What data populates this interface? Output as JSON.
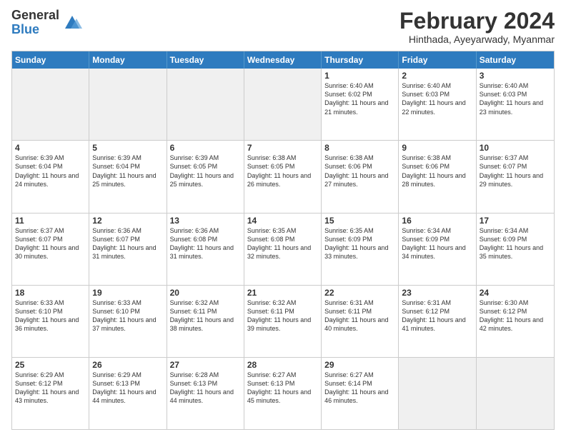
{
  "logo": {
    "general": "General",
    "blue": "Blue"
  },
  "title": "February 2024",
  "subtitle": "Hinthada, Ayeyarwady, Myanmar",
  "days": [
    "Sunday",
    "Monday",
    "Tuesday",
    "Wednesday",
    "Thursday",
    "Friday",
    "Saturday"
  ],
  "weeks": [
    [
      {
        "day": "",
        "lines": []
      },
      {
        "day": "",
        "lines": []
      },
      {
        "day": "",
        "lines": []
      },
      {
        "day": "",
        "lines": []
      },
      {
        "day": "1",
        "lines": [
          "Sunrise: 6:40 AM",
          "Sunset: 6:02 PM",
          "Daylight: 11 hours and 21 minutes."
        ]
      },
      {
        "day": "2",
        "lines": [
          "Sunrise: 6:40 AM",
          "Sunset: 6:03 PM",
          "Daylight: 11 hours and 22 minutes."
        ]
      },
      {
        "day": "3",
        "lines": [
          "Sunrise: 6:40 AM",
          "Sunset: 6:03 PM",
          "Daylight: 11 hours and 23 minutes."
        ]
      }
    ],
    [
      {
        "day": "4",
        "lines": [
          "Sunrise: 6:39 AM",
          "Sunset: 6:04 PM",
          "Daylight: 11 hours and 24 minutes."
        ]
      },
      {
        "day": "5",
        "lines": [
          "Sunrise: 6:39 AM",
          "Sunset: 6:04 PM",
          "Daylight: 11 hours and 25 minutes."
        ]
      },
      {
        "day": "6",
        "lines": [
          "Sunrise: 6:39 AM",
          "Sunset: 6:05 PM",
          "Daylight: 11 hours and 25 minutes."
        ]
      },
      {
        "day": "7",
        "lines": [
          "Sunrise: 6:38 AM",
          "Sunset: 6:05 PM",
          "Daylight: 11 hours and 26 minutes."
        ]
      },
      {
        "day": "8",
        "lines": [
          "Sunrise: 6:38 AM",
          "Sunset: 6:06 PM",
          "Daylight: 11 hours and 27 minutes."
        ]
      },
      {
        "day": "9",
        "lines": [
          "Sunrise: 6:38 AM",
          "Sunset: 6:06 PM",
          "Daylight: 11 hours and 28 minutes."
        ]
      },
      {
        "day": "10",
        "lines": [
          "Sunrise: 6:37 AM",
          "Sunset: 6:07 PM",
          "Daylight: 11 hours and 29 minutes."
        ]
      }
    ],
    [
      {
        "day": "11",
        "lines": [
          "Sunrise: 6:37 AM",
          "Sunset: 6:07 PM",
          "Daylight: 11 hours and 30 minutes."
        ]
      },
      {
        "day": "12",
        "lines": [
          "Sunrise: 6:36 AM",
          "Sunset: 6:07 PM",
          "Daylight: 11 hours and 31 minutes."
        ]
      },
      {
        "day": "13",
        "lines": [
          "Sunrise: 6:36 AM",
          "Sunset: 6:08 PM",
          "Daylight: 11 hours and 31 minutes."
        ]
      },
      {
        "day": "14",
        "lines": [
          "Sunrise: 6:35 AM",
          "Sunset: 6:08 PM",
          "Daylight: 11 hours and 32 minutes."
        ]
      },
      {
        "day": "15",
        "lines": [
          "Sunrise: 6:35 AM",
          "Sunset: 6:09 PM",
          "Daylight: 11 hours and 33 minutes."
        ]
      },
      {
        "day": "16",
        "lines": [
          "Sunrise: 6:34 AM",
          "Sunset: 6:09 PM",
          "Daylight: 11 hours and 34 minutes."
        ]
      },
      {
        "day": "17",
        "lines": [
          "Sunrise: 6:34 AM",
          "Sunset: 6:09 PM",
          "Daylight: 11 hours and 35 minutes."
        ]
      }
    ],
    [
      {
        "day": "18",
        "lines": [
          "Sunrise: 6:33 AM",
          "Sunset: 6:10 PM",
          "Daylight: 11 hours and 36 minutes."
        ]
      },
      {
        "day": "19",
        "lines": [
          "Sunrise: 6:33 AM",
          "Sunset: 6:10 PM",
          "Daylight: 11 hours and 37 minutes."
        ]
      },
      {
        "day": "20",
        "lines": [
          "Sunrise: 6:32 AM",
          "Sunset: 6:11 PM",
          "Daylight: 11 hours and 38 minutes."
        ]
      },
      {
        "day": "21",
        "lines": [
          "Sunrise: 6:32 AM",
          "Sunset: 6:11 PM",
          "Daylight: 11 hours and 39 minutes."
        ]
      },
      {
        "day": "22",
        "lines": [
          "Sunrise: 6:31 AM",
          "Sunset: 6:11 PM",
          "Daylight: 11 hours and 40 minutes."
        ]
      },
      {
        "day": "23",
        "lines": [
          "Sunrise: 6:31 AM",
          "Sunset: 6:12 PM",
          "Daylight: 11 hours and 41 minutes."
        ]
      },
      {
        "day": "24",
        "lines": [
          "Sunrise: 6:30 AM",
          "Sunset: 6:12 PM",
          "Daylight: 11 hours and 42 minutes."
        ]
      }
    ],
    [
      {
        "day": "25",
        "lines": [
          "Sunrise: 6:29 AM",
          "Sunset: 6:12 PM",
          "Daylight: 11 hours and 43 minutes."
        ]
      },
      {
        "day": "26",
        "lines": [
          "Sunrise: 6:29 AM",
          "Sunset: 6:13 PM",
          "Daylight: 11 hours and 44 minutes."
        ]
      },
      {
        "day": "27",
        "lines": [
          "Sunrise: 6:28 AM",
          "Sunset: 6:13 PM",
          "Daylight: 11 hours and 44 minutes."
        ]
      },
      {
        "day": "28",
        "lines": [
          "Sunrise: 6:27 AM",
          "Sunset: 6:13 PM",
          "Daylight: 11 hours and 45 minutes."
        ]
      },
      {
        "day": "29",
        "lines": [
          "Sunrise: 6:27 AM",
          "Sunset: 6:14 PM",
          "Daylight: 11 hours and 46 minutes."
        ]
      },
      {
        "day": "",
        "lines": []
      },
      {
        "day": "",
        "lines": []
      }
    ]
  ]
}
